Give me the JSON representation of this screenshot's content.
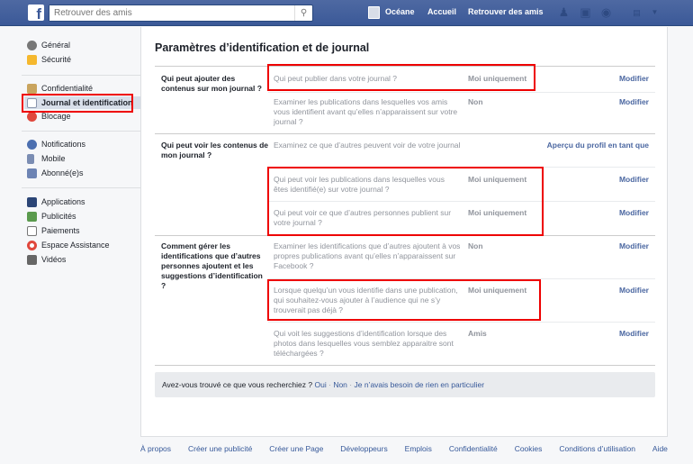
{
  "header": {
    "search_placeholder": "Retrouver des amis",
    "user": "Océane",
    "home": "Accueil",
    "find_friends": "Retrouver des amis",
    "brand_color": "#3b5998"
  },
  "sidebar": {
    "items": [
      {
        "label": "Général",
        "icon": "gears-icon"
      },
      {
        "label": "Sécurité",
        "icon": "shield-icon"
      },
      {
        "label": "Confidentialité",
        "icon": "lock-icon"
      },
      {
        "label": "Journal et identification",
        "icon": "timeline-icon",
        "active": true
      },
      {
        "label": "Blocage",
        "icon": "block-icon"
      },
      {
        "label": "Notifications",
        "icon": "globe-icon"
      },
      {
        "label": "Mobile",
        "icon": "mobile-icon"
      },
      {
        "label": "Abonné(e)s",
        "icon": "rss-icon"
      },
      {
        "label": "Applications",
        "icon": "apps-icon"
      },
      {
        "label": "Publicités",
        "icon": "ads-icon"
      },
      {
        "label": "Paiements",
        "icon": "card-icon"
      },
      {
        "label": "Espace Assistance",
        "icon": "lifebuoy-icon"
      },
      {
        "label": "Vidéos",
        "icon": "film-icon"
      }
    ]
  },
  "main": {
    "title": "Paramètres d’identification et de journal",
    "sections": [
      {
        "label": "Qui peut ajouter des contenus sur mon journal ?",
        "rows": [
          {
            "question": "Qui peut publier dans votre journal ?",
            "value": "Moi uniquement",
            "action": "Modifier"
          },
          {
            "question": "Examiner les publications dans lesquelles vos amis vous identifient avant qu’elles n’apparaissent sur votre journal ?",
            "value": "Non",
            "action": "Modifier"
          }
        ]
      },
      {
        "label": "Qui peut voir les contenus de mon journal ?",
        "rows": [
          {
            "question": "Examinez ce que d’autres peuvent voir de votre journal",
            "value": "",
            "action": "Aperçu du profil en tant que"
          },
          {
            "question": "Qui peut voir les publications dans lesquelles vous êtes identifié(e) sur votre journal ?",
            "value": "Moi uniquement",
            "action": "Modifier"
          },
          {
            "question": "Qui peut voir ce que d’autres personnes publient sur votre journal ?",
            "value": "Moi uniquement",
            "action": "Modifier"
          }
        ]
      },
      {
        "label": "Comment gérer les identifications que d’autres personnes ajoutent et les suggestions d’identification ?",
        "rows": [
          {
            "question": "Examiner les identifications que d’autres ajoutent à vos propres publications avant qu’elles n’apparaissent sur Facebook ?",
            "value": "Non",
            "action": "Modifier"
          },
          {
            "question": "Lorsque quelqu’un vous identifie dans une publication, qui souhaitez-vous ajouter à l’audience qui ne s’y trouverait pas déjà ?",
            "value": "Moi uniquement",
            "action": "Modifier"
          },
          {
            "question": "Qui voit les suggestions d’identification lorsque des photos dans lesquelles vous semblez apparaitre sont téléchargées ?",
            "value": "Amis",
            "action": "Modifier"
          }
        ]
      }
    ],
    "feedback": {
      "question": "Avez-vous trouvé ce que vous recherchiez ?",
      "yes": "Oui",
      "no": "Non",
      "neutral": "Je n’avais besoin de rien en particulier",
      "sep": "·"
    }
  },
  "footer": [
    "À propos",
    "Créer une publicité",
    "Créer une Page",
    "Développeurs",
    "Emplois",
    "Confidentialité",
    "Cookies",
    "Conditions d’utilisation",
    "Aide"
  ],
  "highlight_color": "#ee0000"
}
